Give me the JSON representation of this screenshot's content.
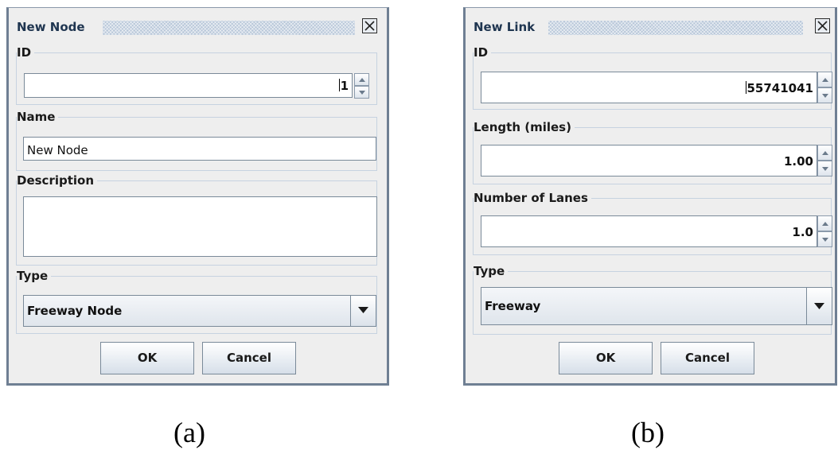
{
  "dialog_a": {
    "title": "New Node",
    "id_label": "ID",
    "id_value": "1",
    "name_label": "Name",
    "name_value": "New Node",
    "description_label": "Description",
    "description_value": "",
    "type_label": "Type",
    "type_value": "Freeway Node",
    "ok_label": "OK",
    "cancel_label": "Cancel"
  },
  "dialog_b": {
    "title": "New Link",
    "id_label": "ID",
    "id_value": "55741041",
    "length_label": "Length (miles)",
    "length_value": "1.00",
    "lanes_label": "Number of Lanes",
    "lanes_value": "1.0",
    "type_label": "Type",
    "type_value": "Freeway",
    "ok_label": "OK",
    "cancel_label": "Cancel"
  },
  "captions": {
    "a": "(a)",
    "b": "(b)"
  },
  "colors": {
    "dialog_background": "#eeeeee",
    "frame_border": "#6f7f93",
    "title_text": "#1f3550",
    "field_border": "#7a8a99"
  },
  "icons": {
    "close": "close-icon",
    "spin_up": "chevron-up-icon",
    "spin_down": "chevron-down-icon",
    "combo_arrow": "triangle-down-icon"
  }
}
